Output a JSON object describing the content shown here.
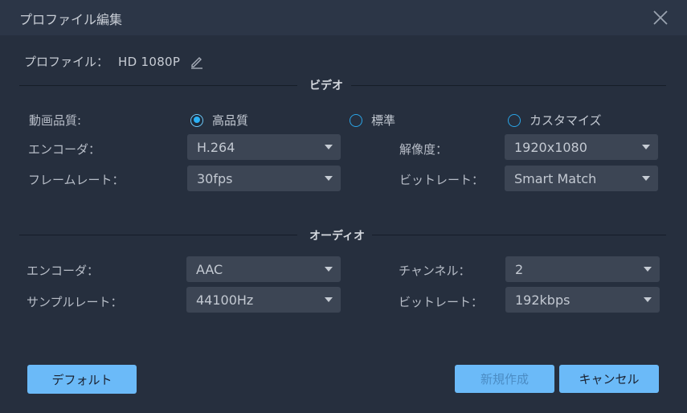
{
  "window": {
    "title": "プロファイル編集",
    "close_icon": "close-icon"
  },
  "profile": {
    "label": "プロファイル：",
    "name": "HD 1080P",
    "edit_icon": "pencil-icon"
  },
  "video": {
    "section_title": "ビデオ",
    "quality_label": "動画品質:",
    "quality_options": [
      {
        "label": "高品質",
        "selected": true
      },
      {
        "label": "標準",
        "selected": false
      },
      {
        "label": "カスタマイズ",
        "selected": false
      }
    ],
    "encoder_label": "エンコーダ：",
    "encoder_value": "H.264",
    "resolution_label": "解像度：",
    "resolution_value": "1920x1080",
    "framerate_label": "フレームレート：",
    "framerate_value": "30fps",
    "bitrate_label": "ビットレート：",
    "bitrate_value": "Smart Match"
  },
  "audio": {
    "section_title": "オーディオ",
    "encoder_label": "エンコーダ：",
    "encoder_value": "AAC",
    "channel_label": "チャンネル：",
    "channel_value": "2",
    "samplerate_label": "サンプルレート：",
    "samplerate_value": "44100Hz",
    "bitrate_label": "ビットレート：",
    "bitrate_value": "192kbps"
  },
  "buttons": {
    "default_label": "デフォルト",
    "create_label": "新規作成",
    "cancel_label": "キャンセル"
  },
  "colors": {
    "accent": "#2ab1f5",
    "button": "#6bbaf8",
    "background": "#262f3e",
    "titlebar": "#2c3647"
  }
}
